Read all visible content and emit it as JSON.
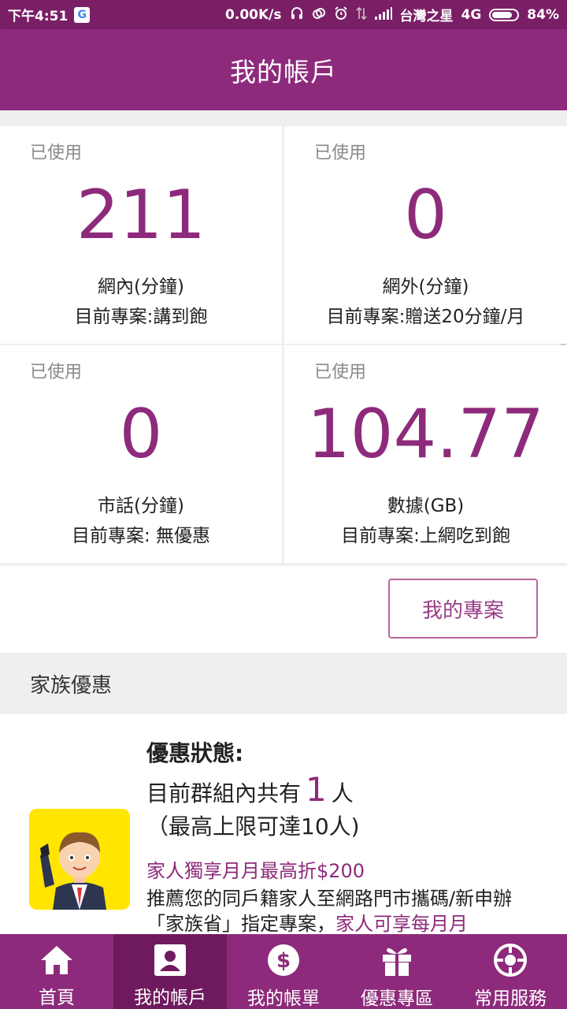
{
  "status_bar": {
    "time": "下午4:51",
    "google_badge": "G",
    "net_speed": "0.00K/s",
    "carrier": "台灣之星",
    "network": "4G",
    "battery_percent": "84%",
    "battery_level": 0.84
  },
  "header": {
    "title": "我的帳戶"
  },
  "usage": [
    {
      "used_label": "已使用",
      "value": "211",
      "label": "網內(分鐘)",
      "plan": "目前專案:講到飽"
    },
    {
      "used_label": "已使用",
      "value": "0",
      "label": "網外(分鐘)",
      "plan": "目前專案:贈送20分鐘/月"
    },
    {
      "used_label": "已使用",
      "value": "0",
      "label": "市話(分鐘)",
      "plan": "目前專案: 無優惠"
    },
    {
      "used_label": "已使用",
      "value": "104.77",
      "label": "數據(GB)",
      "plan": "目前專案:上網吃到飽"
    }
  ],
  "my_plan_button": "我的專案",
  "family": {
    "section_title": "家族優惠",
    "status_title": "優惠狀態:",
    "group_prefix": "目前群組內共有",
    "group_count": "1",
    "group_suffix": "人",
    "limit_text": "（最高上限可達10人)",
    "promo_title": "家人獨享月月最高折$200",
    "promo_body": "推薦您的同戶籍家人至網路門市攜碼/新申辦「家族省」指定專案，",
    "promo_emphasis": "家人可享每月月"
  },
  "nav": [
    {
      "label": "首頁",
      "icon": "home-icon"
    },
    {
      "label": "我的帳戶",
      "icon": "account-icon"
    },
    {
      "label": "我的帳單",
      "icon": "bill-icon"
    },
    {
      "label": "優惠專區",
      "icon": "gift-icon"
    },
    {
      "label": "常用服務",
      "icon": "services-icon"
    }
  ],
  "colors": {
    "primary": "#8e2a7b",
    "status_bar": "#7a1f66",
    "nav_active": "#6f1a5e",
    "accent_text": "#8e2a7b"
  }
}
